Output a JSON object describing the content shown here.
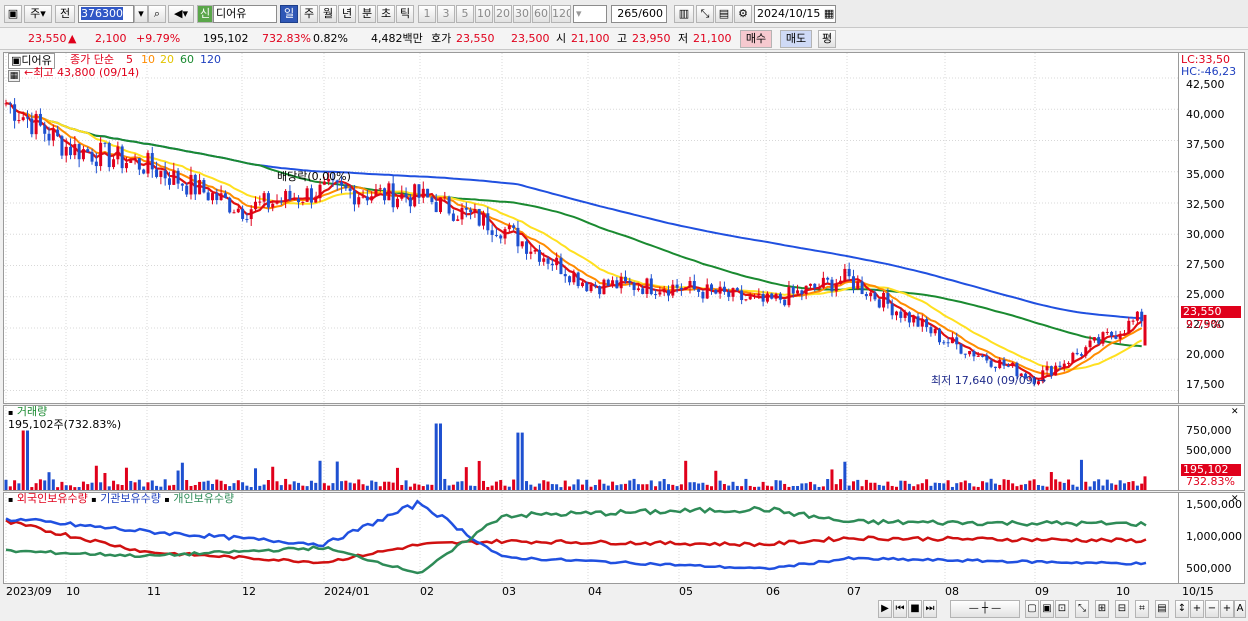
{
  "toolbar": {
    "period_main": "주",
    "jeon": "전",
    "code": "376300",
    "shin": "신",
    "name": "디어유",
    "periods": [
      "일",
      "주",
      "월",
      "년",
      "분",
      "초",
      "틱"
    ],
    "selected_period": "일",
    "intervals": [
      "1",
      "3",
      "5",
      "10",
      "20",
      "30",
      "60",
      "120"
    ],
    "count": "265",
    "total": "/600",
    "date": "2024/10/15"
  },
  "quote": {
    "price": "23,550",
    "arrow": "▲",
    "change": "2,100",
    "change_pct": "+9.79%",
    "volume": "195,102",
    "volume_ratio": "732.83%",
    "turnover": "0.82%",
    "amount": "4,482백만",
    "ho_label": "호가",
    "ask": "23,550",
    "bid": "23,500",
    "open_label": "시",
    "open": "21,100",
    "high_label": "고",
    "high": "23,950",
    "low_label": "저",
    "low": "21,100",
    "buy_label": "매수",
    "sell_label": "매도",
    "avg_label": "평"
  },
  "price_panel": {
    "name_label": "디어유",
    "ma_legend": "종가 단순",
    "ma_periods": [
      "5",
      "10",
      "20",
      "60",
      "120"
    ],
    "high_mark": "최고 43,800 (09/14)",
    "low_mark": "최저 17,640 (09/09)",
    "dividend_mark": "배당락(0.00%)",
    "lc": "LC:33,50",
    "hc": "HC:-46,23",
    "y_ticks": [
      "42,500",
      "40,000",
      "37,500",
      "35,000",
      "32,500",
      "30,000",
      "27,500",
      "25,000",
      "22,500",
      "20,000",
      "17,500"
    ],
    "last_price_tag": "23,550",
    "last_pct_tag": "9.79%"
  },
  "volume_panel": {
    "title": "거래량",
    "value": "195,102주(732.83%)",
    "y_ticks": [
      "750,000",
      "500,000",
      "250,000"
    ],
    "tag_value": "195,102",
    "tag_pct": "732.83%"
  },
  "holding_panel": {
    "legend": [
      "외국인보유수량",
      "기관보유수량",
      "개인보유수량"
    ],
    "y_ticks": [
      "1,500,000",
      "1,000,000",
      "500,000"
    ]
  },
  "x_axis": {
    "labels": [
      "2023/09",
      "10",
      "11",
      "12",
      "2024/01",
      "02",
      "03",
      "04",
      "05",
      "06",
      "07",
      "08",
      "09",
      "10"
    ],
    "end_label": "10/15"
  },
  "chart_data": [
    {
      "type": "candlestick",
      "title": "디어유",
      "x_range": [
        "2023/09",
        "2024/10/15"
      ],
      "ylim": [
        16500,
        44500
      ],
      "close_approx": [
        [
          "2023/09",
          40500
        ],
        [
          "2023/10",
          37000
        ],
        [
          "2023/11",
          35500
        ],
        [
          "2023/12",
          32000
        ],
        [
          "2024/01",
          33500
        ],
        [
          "2024/02",
          33000
        ],
        [
          "2024/03",
          30500
        ],
        [
          "2024/04",
          26000
        ],
        [
          "2024/05",
          25800
        ],
        [
          "2024/06",
          24500
        ],
        [
          "2024/07",
          26500
        ],
        [
          "2024/08",
          21500
        ],
        [
          "2024/09",
          18500
        ],
        [
          "2024/10/15",
          23550
        ]
      ],
      "high": {
        "value": 43800,
        "date": "09/14"
      },
      "low": {
        "value": 17640,
        "date": "09/09"
      },
      "series": [
        {
          "name": "5",
          "color": "#e01010"
        },
        {
          "name": "10",
          "color": "#ff8c00"
        },
        {
          "name": "20",
          "color": "#ffe020"
        },
        {
          "name": "60",
          "color": "#1a8a30"
        },
        {
          "name": "120",
          "color": "#2050e0"
        }
      ]
    },
    {
      "type": "bar",
      "title": "거래량",
      "ylim": [
        0,
        1000000
      ],
      "last": 195102,
      "peaks": [
        [
          "2023/09",
          850000
        ],
        [
          "2024/02",
          950000
        ],
        [
          "2024/03",
          820000
        ]
      ]
    },
    {
      "type": "line",
      "ylim": [
        300000,
        1700000
      ],
      "series": [
        {
          "name": "외국인보유수량",
          "color": "#d01010",
          "values": [
            [
              "2023/09",
              1250000
            ],
            [
              "2023/11",
              780000
            ],
            [
              "2024/01",
              620000
            ],
            [
              "2024/02",
              900000
            ],
            [
              "2024/03",
              950000
            ],
            [
              "2024/06",
              900000
            ],
            [
              "2024/07",
              1000000
            ],
            [
              "2024/10/15",
              960000
            ]
          ]
        },
        {
          "name": "기관보유수량",
          "color": "#2050e0",
          "values": [
            [
              "2023/09",
              1300000
            ],
            [
              "2023/11",
              1100000
            ],
            [
              "2024/01",
              900000
            ],
            [
              "2024/02",
              1550000
            ],
            [
              "2024/03",
              700000
            ],
            [
              "2024/06",
              520000
            ],
            [
              "2024/07",
              680000
            ],
            [
              "2024/10/15",
              600000
            ]
          ]
        },
        {
          "name": "개인보유수량",
          "color": "#2e8b57",
          "values": [
            [
              "2023/09",
              800000
            ],
            [
              "2023/11",
              720000
            ],
            [
              "2024/01",
              850000
            ],
            [
              "2024/02",
              450000
            ],
            [
              "2024/03",
              1350000
            ],
            [
              "2024/06",
              1450000
            ],
            [
              "2024/07",
              1250000
            ],
            [
              "2024/10/15",
              1220000
            ]
          ]
        }
      ]
    }
  ]
}
